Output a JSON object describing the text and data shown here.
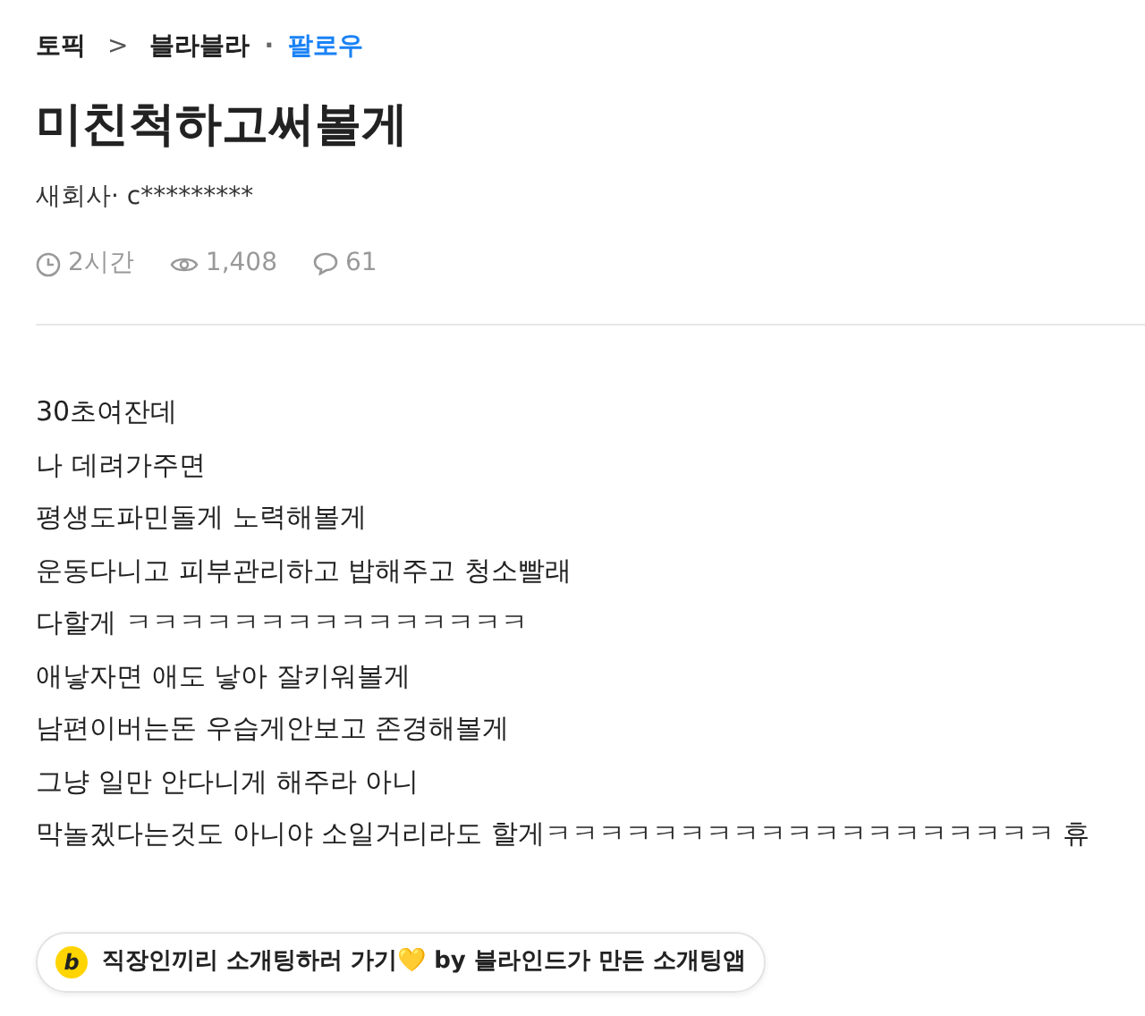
{
  "breadcrumb": {
    "topic": "토픽",
    "separator": ">",
    "board": "블라블라",
    "dot": "·",
    "follow": "팔로우"
  },
  "title": "미친척하고써볼게",
  "author": "새회사· c*********",
  "stats": {
    "time": "2시간",
    "views": "1,408",
    "comments": "61"
  },
  "body": [
    "30초여잔데",
    "나 데려가주면",
    "평생도파민돌게 노력해볼게",
    "운동다니고 피부관리하고 밥해주고 청소빨래",
    "다할게 ㅋㅋㅋㅋㅋㅋㅋㅋㅋㅋㅋㅋㅋㅋㅋ",
    "애낳자면 애도 낳아 잘키워볼게",
    "남편이버는돈 우습게안보고 존경해볼게",
    "그냥 일만 안다니게 해주라 아니",
    "막놀겠다는것도 아니야 소일거리라도 할게ㅋㅋㅋㅋㅋㅋㅋㅋㅋㅋㅋㅋㅋㅋㅋㅋㅋㅋㅋ 휴"
  ],
  "promo": {
    "logo": "b",
    "text": "직장인끼리 소개팅하러 가기💛 by 블라인드가 만든 소개팅앱"
  }
}
